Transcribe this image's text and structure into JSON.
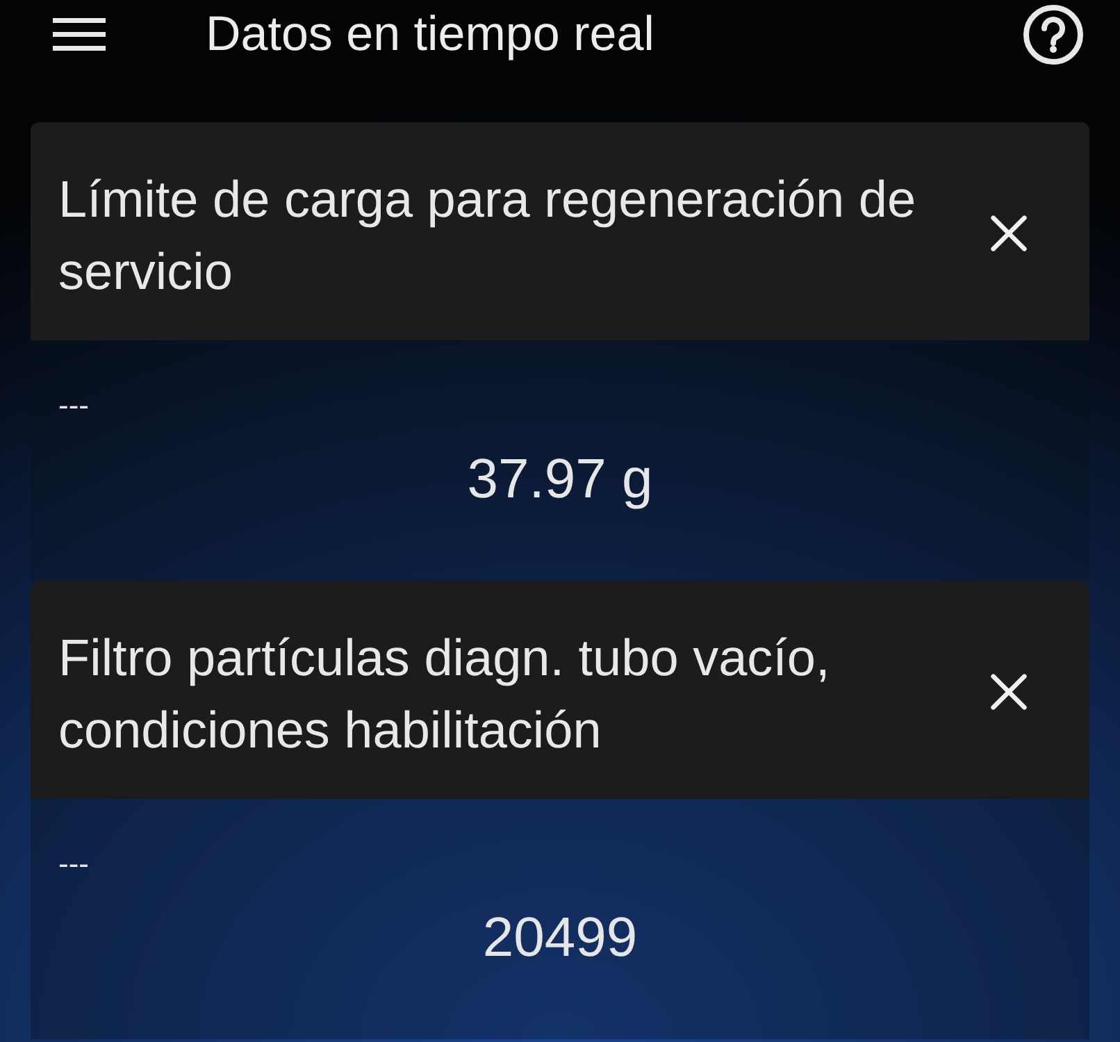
{
  "app_bar": {
    "title": "Datos en tiempo real"
  },
  "cards": [
    {
      "title": "Límite de carga para regeneración de servicio",
      "subtitle": "---",
      "value": "37.97 g"
    },
    {
      "title": "Filtro partículas diagn. tubo vacío, condiciones habilitación",
      "subtitle": "---",
      "value": "20499"
    }
  ]
}
